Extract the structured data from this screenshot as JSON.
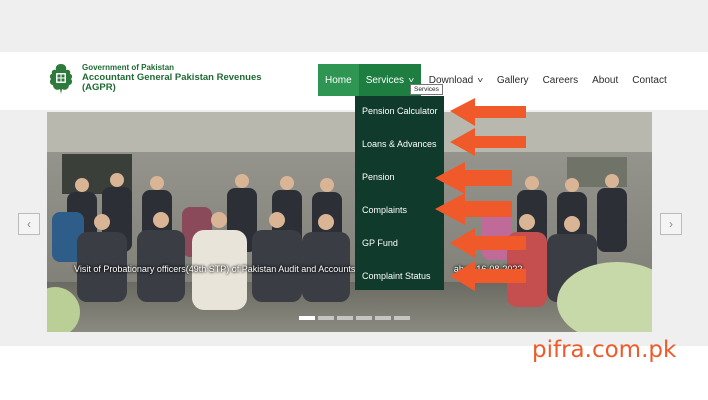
{
  "org": {
    "line1": "Government of Pakistan",
    "line2": "Accountant General Pakistan Revenues",
    "line3": "(AGPR)"
  },
  "nav": {
    "home": "Home",
    "services": "Services",
    "download": "Download",
    "gallery": "Gallery",
    "careers": "Careers",
    "about": "About",
    "contact": "Contact"
  },
  "tooltip": "Services",
  "dropdown": {
    "items": [
      "Pension Calculator",
      "Loans & Advances",
      "Pension",
      "Complaints",
      "GP Fund",
      "Complaint Status"
    ]
  },
  "slider": {
    "caption": "Visit of Probationary officers(49th STP) of Pakistan Audit and Accounts",
    "caption_tail": "abad 16-08-2022"
  },
  "brand": "pifra.com.pk",
  "colors": {
    "nav_active": "#2e9552",
    "dropdown_bg": "#0f3a2c",
    "arrow": "#f05a2a",
    "org_text": "#1e6b34"
  }
}
